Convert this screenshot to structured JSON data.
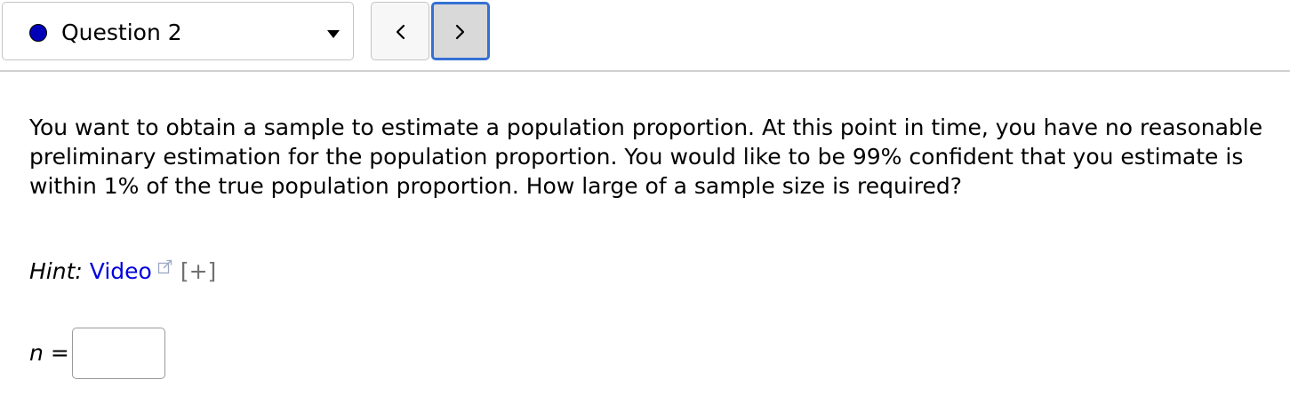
{
  "question_nav": {
    "selected_label": "Question 2",
    "status_color": "#0000b8",
    "dropdown_icon": "caret-down-icon",
    "prev_icon": "chevron-left-icon",
    "next_icon": "chevron-right-icon",
    "active_border_color": "#3570d4"
  },
  "question": {
    "prompt": "You want to obtain a sample to estimate a population proportion. At this point in time, you have no reasonable preliminary estimation for the population proportion. You would like to be 99% confident that you estimate is within 1% of the true population proportion. How large of a sample size is required?",
    "hint_label": "Hint:",
    "hint_link_text": "Video",
    "hint_link_color": "#0000e0",
    "hint_link_icon": "external-link-icon",
    "hint_expand": "[+]",
    "answer_variable": "n",
    "answer_equals": "=",
    "answer_value": ""
  }
}
